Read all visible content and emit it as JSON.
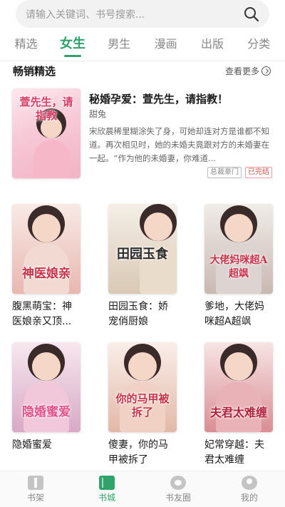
{
  "search": {
    "placeholder": "请输入关键词、书号搜索..."
  },
  "tabs": [
    {
      "label": "精选",
      "active": false
    },
    {
      "label": "女生",
      "active": true
    },
    {
      "label": "男生",
      "active": false
    },
    {
      "label": "漫画",
      "active": false
    },
    {
      "label": "出版",
      "active": false
    },
    {
      "label": "分类",
      "active": false
    }
  ],
  "section": {
    "title": "畅销精选",
    "see_more": "查看更多"
  },
  "featured": {
    "title": "秘婚孕爱：萱先生，请指教！",
    "author": "甜兔",
    "description": "宋欣晨稀里糊涂失了身，可她却连对方是谁都不知道。再次相见时，她的未婚夫竟跟对方的未婚妻在一起。“作为他的未婚妻，你难道...",
    "tags": [
      "总裁豪门",
      "已完结"
    ],
    "cover_text": "萱先生，请指教"
  },
  "books": [
    {
      "title": "腹黑萌宝：神医娘亲又顶...",
      "cover_text": "神医娘亲",
      "cover_colors": [
        "#f9eae6",
        "#e8b7b0"
      ]
    },
    {
      "title": "田园玉食：娇宠俏厨娘",
      "cover_text": "田园玉食",
      "cover_colors": [
        "#f4efe7",
        "#d9c8b4"
      ]
    },
    {
      "title": "爹地，大佬妈咪超A超飒",
      "cover_text": "大佬妈咪超A超飒",
      "cover_colors": [
        "#f0ece8",
        "#c9b8b2"
      ]
    },
    {
      "title": "隐婚蜜爱",
      "cover_text": "隐婚蜜爱",
      "cover_colors": [
        "#f7e7ef",
        "#d8a9c5"
      ]
    },
    {
      "title": "傻妻，你的马甲被拆了",
      "cover_text": "你的马甲被拆了",
      "cover_colors": [
        "#fbeeea",
        "#e2b9a8"
      ]
    },
    {
      "title": "妃常穿越：夫君太难缠",
      "cover_text": "夫君太难缠",
      "cover_colors": [
        "#f7e4e4",
        "#d98e94"
      ]
    }
  ],
  "bottom_nav": [
    {
      "label": "书架",
      "icon": "bookshelf-icon",
      "active": false
    },
    {
      "label": "书城",
      "icon": "bookstore-icon",
      "active": true
    },
    {
      "label": "书友圈",
      "icon": "friends-circle-icon",
      "active": false
    },
    {
      "label": "我的",
      "icon": "profile-icon",
      "active": false
    }
  ],
  "colors": {
    "accent": "#2fa36b",
    "tag_status": "#d05050"
  }
}
